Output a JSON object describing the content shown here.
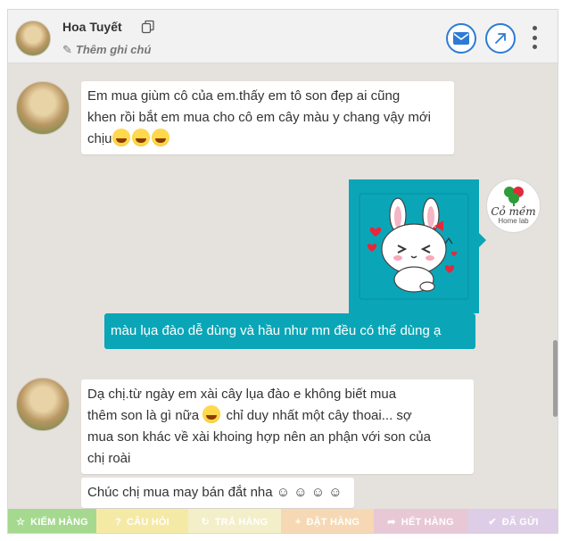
{
  "header": {
    "contact_name": "Hoa Tuyết",
    "note_label": "Thêm ghi chú"
  },
  "messages": [
    {
      "id": "m1",
      "direction": "incoming",
      "lines": [
        "Em mua giùm cô của em.thấy em tô son đẹp ai cũng",
        "khen rồi bắt em mua cho cô em cây màu y chang vậy mới",
        "chịu"
      ],
      "trailing_emoji": [
        "laughing-tears-emoji",
        "laughing-tears-emoji",
        "laughing-tears-emoji"
      ]
    },
    {
      "id": "m2",
      "direction": "outgoing",
      "type": "sticker",
      "sticker": "cute-bunny-hearts-sticker"
    },
    {
      "id": "m3",
      "direction": "outgoing",
      "text": "màu lụa đào dễ dùng và hầu như mn đều có thể dùng ạ"
    },
    {
      "id": "m4",
      "direction": "incoming",
      "lines": [
        "Dạ chị.từ ngày em xài cây lụa đào e không biết mua",
        "thêm son là gì nữa",
        "chỉ duy nhất một cây thoai... sợ",
        "mua son khác về xài khoing hợp nên an phận với son của",
        "chị roài"
      ]
    },
    {
      "id": "m5",
      "direction": "incoming",
      "text": "Chúc chị mua may bán đắt nha ☺ ☺ ☺ ☺"
    }
  ],
  "brand": {
    "name": "Cỏ mềm",
    "sub": "Home lab"
  },
  "actions": [
    {
      "label": "KIẾM HÀNG",
      "icon": "star-icon",
      "glyph": "☆",
      "color": "#a5d98f"
    },
    {
      "label": "CÂU HỎI",
      "icon": "question-icon",
      "glyph": "?",
      "color": "#f5e9a6"
    },
    {
      "label": "TRẢ HÀNG",
      "icon": "refresh-icon",
      "glyph": "↻",
      "color": "#f3efc9"
    },
    {
      "label": "ĐẶT HÀNG",
      "icon": "plus-icon",
      "glyph": "+",
      "color": "#f6d9b4"
    },
    {
      "label": "HẾT HÀNG",
      "icon": "share-icon",
      "glyph": "➦",
      "color": "#e8c8d4"
    },
    {
      "label": "ĐÃ GỬI",
      "icon": "check-icon",
      "glyph": "✔",
      "color": "#ddcde6"
    }
  ],
  "colors": {
    "accent": "#2d7bd5",
    "sent_bubble": "#0aa6b8",
    "chat_bg": "#e5e1dd"
  }
}
